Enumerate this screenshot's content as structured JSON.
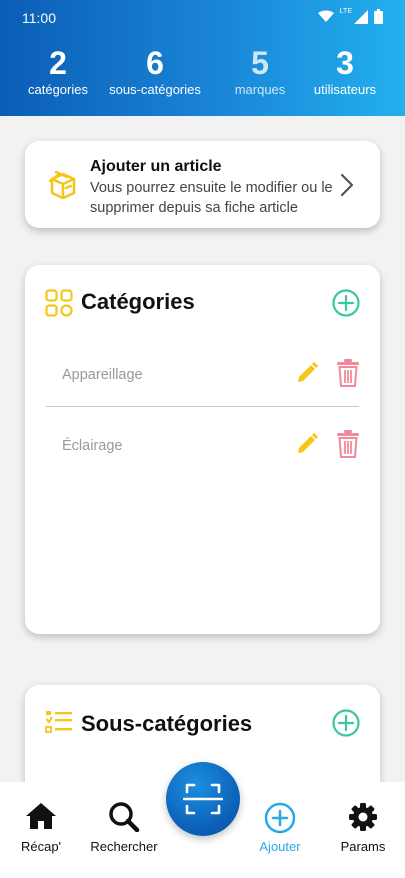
{
  "status_bar": {
    "time": "11:00",
    "network": "LTE"
  },
  "stats": [
    {
      "value": "2",
      "label": "catégories",
      "dimmed": false
    },
    {
      "value": "6",
      "label": "sous-catégories",
      "dimmed": false
    },
    {
      "value": "5",
      "label": "marques",
      "dimmed": true
    },
    {
      "value": "3",
      "label": "utilisateurs",
      "dimmed": false
    }
  ],
  "add_article": {
    "title": "Ajouter un article",
    "description": "Vous pourrez ensuite le modifier ou le supprimer depuis sa fiche article",
    "icon": "box-icon"
  },
  "categories": {
    "title": "Catégories",
    "icon": "grid-icon",
    "items": [
      "Appareillage",
      "Éclairage"
    ]
  },
  "subcategories": {
    "title": "Sous-catégories",
    "icon": "list-icon"
  },
  "bottom_nav": {
    "items": [
      {
        "label": "Récap'",
        "icon": "home-icon",
        "active": false
      },
      {
        "label": "Rechercher",
        "icon": "search-icon",
        "active": false
      },
      {
        "label": "Ajouter",
        "icon": "add-circle-icon",
        "active": true
      },
      {
        "label": "Params",
        "icon": "gear-icon",
        "active": false
      }
    ],
    "center_button_icon": "scan-icon"
  },
  "colors": {
    "header_gradient_start": "#0b5db5",
    "header_gradient_end": "#22b0ee",
    "accent_yellow": "#f5c518",
    "accent_green": "#3cc6a0",
    "delete_pink": "#f08a9a",
    "active_blue": "#29a8e6"
  }
}
